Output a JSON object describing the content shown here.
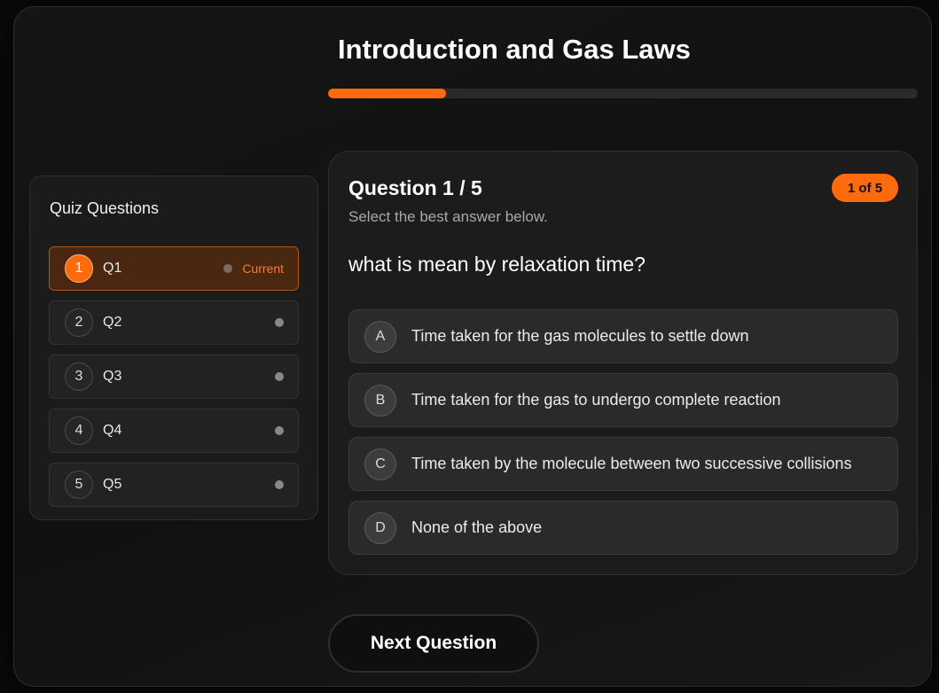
{
  "quiz": {
    "title": "Introduction and Gas Laws",
    "progress_fraction": 0.2
  },
  "sidebar": {
    "title": "Quiz Questions",
    "items": [
      {
        "number": "1",
        "label": "Q1",
        "status": "Current",
        "current": true
      },
      {
        "number": "2",
        "label": "Q2",
        "status": "",
        "current": false
      },
      {
        "number": "3",
        "label": "Q3",
        "status": "",
        "current": false
      },
      {
        "number": "4",
        "label": "Q4",
        "status": "",
        "current": false
      },
      {
        "number": "5",
        "label": "Q5",
        "status": "",
        "current": false
      }
    ]
  },
  "card": {
    "heading": "Question 1 / 5",
    "badge": "1 of 5",
    "subtitle": "Select the best answer below.",
    "question": "what is mean by relaxation time?",
    "options": [
      {
        "letter": "A",
        "text": "Time taken for the gas molecules to settle down"
      },
      {
        "letter": "B",
        "text": "Time taken for the gas to undergo complete reaction"
      },
      {
        "letter": "C",
        "text": "Time taken by the molecule between two successive collisions"
      },
      {
        "letter": "D",
        "text": "None of the above"
      }
    ]
  },
  "actions": {
    "next_label": "Next Question"
  },
  "colors": {
    "accent": "#ff6a0d",
    "background": "#111111"
  }
}
